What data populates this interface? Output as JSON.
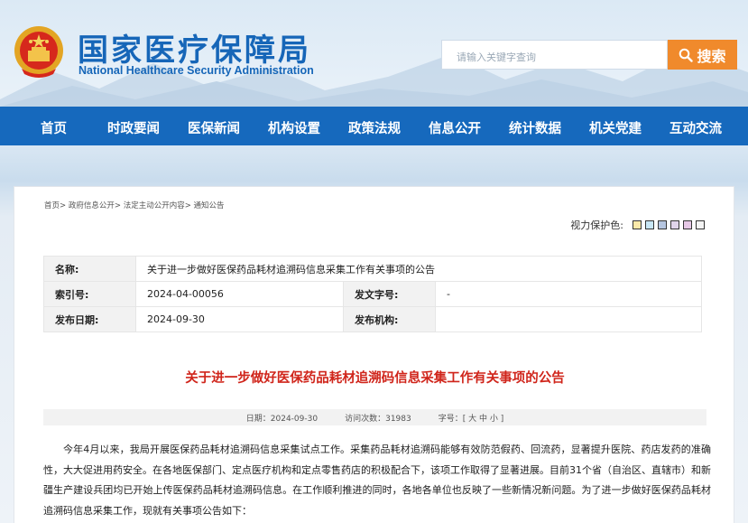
{
  "header": {
    "title_cn": "国家医疗保障局",
    "title_en": "National Healthcare Security Administration",
    "search_placeholder": "请输入关键字查询",
    "search_button": "搜索",
    "brand_color": "#1669bd",
    "accent_color": "#f08a2c"
  },
  "nav": {
    "items": [
      "首页",
      "时政要闻",
      "医保新闻",
      "机构设置",
      "政策法规",
      "信息公开",
      "统计数据",
      "机关党建",
      "互动交流"
    ]
  },
  "breadcrumb": {
    "items": [
      "首页",
      "政府信息公开",
      "法定主动公开内容",
      "通知公告"
    ]
  },
  "vision": {
    "label": "视力保护色:",
    "swatches": [
      "#fbe9a9",
      "#c8e6f5",
      "#b6c6e0",
      "#e0d4ea",
      "#e6c8e6",
      "#f3f3f3"
    ]
  },
  "info": {
    "name_label": "名称:",
    "name_value": "关于进一步做好医保药品耗材追溯码信息采集工作有关事项的公告",
    "index_label": "索引号:",
    "index_value": "2024-04-00056",
    "docno_label": "发文字号:",
    "docno_value": "-",
    "date_label": "发布日期:",
    "date_value": "2024-09-30",
    "org_label": "发布机构:",
    "org_value": ""
  },
  "article": {
    "title": "关于进一步做好医保药品耗材追溯码信息采集工作有关事项的公告",
    "meta_date": "日期：2024-09-30",
    "meta_views": "访问次数：31983",
    "meta_size": "字号：[ 大 中 小 ]",
    "paragraph": "今年4月以来，我局开展医保药品耗材追溯码信息采集试点工作。采集药品耗材追溯码能够有效防范假药、回流药，显著提升医院、药店发药的准确性，大大促进用药安全。在各地医保部门、定点医疗机构和定点零售药店的积极配合下，该项工作取得了显著进展。目前31个省（自治区、直辖市）和新疆生产建设兵团均已开始上传医保药品耗材追溯码信息。在工作顺利推进的同时，各地各单位也反映了一些新情况新问题。为了进一步做好医保药品耗材追溯码信息采集工作，现就有关事项公告如下："
  }
}
